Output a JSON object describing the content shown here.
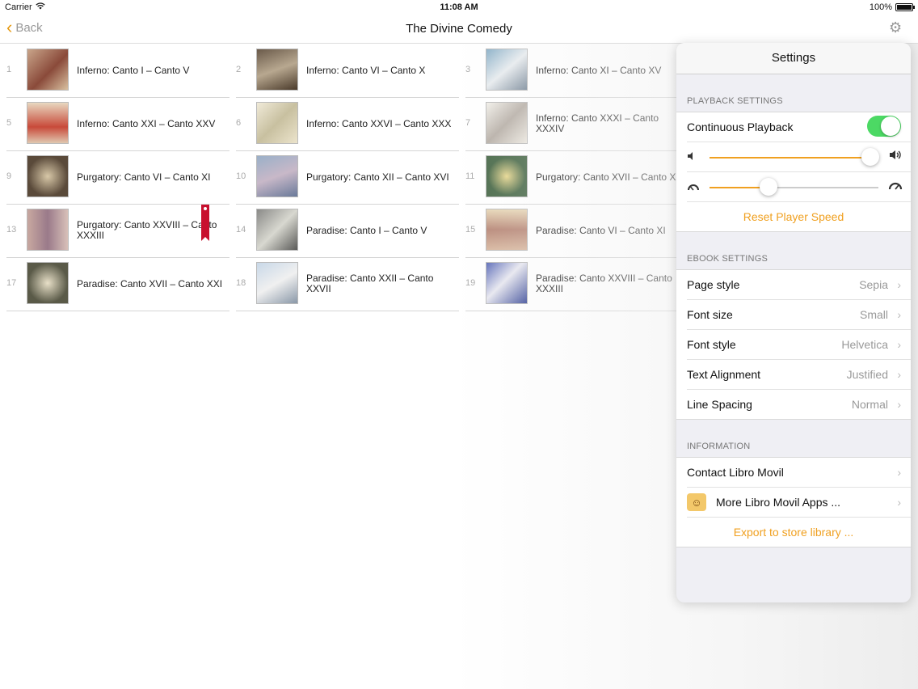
{
  "status_bar": {
    "carrier": "Carrier",
    "time": "11:08 AM",
    "battery": "100%"
  },
  "nav": {
    "back_label": "Back",
    "title": "The Divine Comedy"
  },
  "cantos": [
    {
      "num": "1",
      "label": "Inferno: Canto I – Canto V"
    },
    {
      "num": "2",
      "label": "Inferno: Canto VI – Canto X"
    },
    {
      "num": "3",
      "label": "Inferno: Canto XI – Canto XV"
    },
    {
      "num": "5",
      "label": "Inferno: Canto XXI – Canto XXV"
    },
    {
      "num": "6",
      "label": "Inferno: Canto XXVI – Canto XXX"
    },
    {
      "num": "7",
      "label": "Inferno: Canto XXXI – Canto XXXIV"
    },
    {
      "num": "9",
      "label": "Purgatory: Canto VI – Canto XI"
    },
    {
      "num": "10",
      "label": "Purgatory: Canto XII – Canto XVI"
    },
    {
      "num": "11",
      "label": "Purgatory: Canto XVII – Canto XXI"
    },
    {
      "num": "13",
      "label": "Purgatory: Canto XXVIII – Canto XXXIII"
    },
    {
      "num": "14",
      "label": "Paradise: Canto I – Canto V"
    },
    {
      "num": "15",
      "label": "Paradise: Canto VI – Canto XI"
    },
    {
      "num": "17",
      "label": "Paradise: Canto XVII – Canto XXI"
    },
    {
      "num": "18",
      "label": "Paradise: Canto XXII – Canto XXVII"
    },
    {
      "num": "19",
      "label": "Paradise: Canto XXVIII – Canto XXXIII"
    }
  ],
  "settings": {
    "title": "Settings",
    "playback": {
      "section_title": "PLAYBACK SETTINGS",
      "continuous_label": "Continuous Playback",
      "continuous_on": true,
      "volume_level": 0.95,
      "speed_level": 0.35,
      "reset_label": "Reset Player Speed"
    },
    "ebook": {
      "section_title": "EBOOK SETTINGS",
      "page_style_label": "Page style",
      "page_style_value": "Sepia",
      "font_size_label": "Font size",
      "font_size_value": "Small",
      "font_style_label": "Font style",
      "font_style_value": "Helvetica",
      "alignment_label": "Text Alignment",
      "alignment_value": "Justified",
      "spacing_label": "Line Spacing",
      "spacing_value": "Normal"
    },
    "info": {
      "section_title": "INFORMATION",
      "contact_label": "Contact Libro Movil",
      "more_apps_label": "More Libro Movil Apps ...",
      "export_label": "Export to store library ..."
    }
  },
  "colors": {
    "accent": "#f0a020",
    "toggle_on": "#4cd964",
    "bookmark": "#c8102e"
  }
}
